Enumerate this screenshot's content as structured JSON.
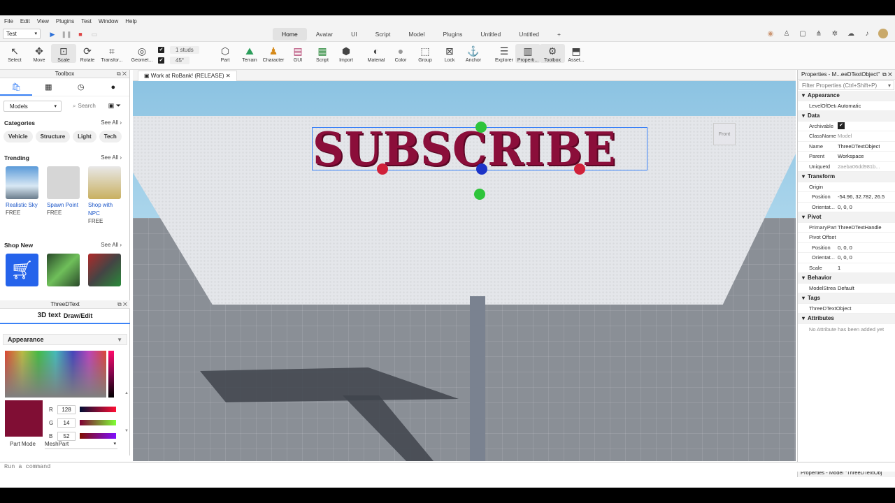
{
  "menu": [
    "File",
    "Edit",
    "View",
    "Plugins",
    "Test",
    "Window",
    "Help"
  ],
  "test_select": "Test",
  "ribbon_tabs": [
    "Home",
    "Avatar",
    "UI",
    "Script",
    "Model",
    "Plugins",
    "Untitled",
    "Untitled",
    "+"
  ],
  "tools": [
    {
      "label": "Select",
      "icon": "↖"
    },
    {
      "label": "Move",
      "icon": "✥"
    },
    {
      "label": "Scale",
      "icon": "⊡"
    },
    {
      "label": "Rotate",
      "icon": "⟳"
    },
    {
      "label": "Transfor...",
      "icon": "⌗"
    },
    {
      "label": "Geomet...",
      "icon": "◎"
    },
    {
      "label": "Part",
      "icon": "⬡"
    },
    {
      "label": "Terrain",
      "icon": "⛰"
    },
    {
      "label": "Character",
      "icon": "♟"
    },
    {
      "label": "GUI",
      "icon": "▤"
    },
    {
      "label": "Script",
      "icon": "▦"
    },
    {
      "label": "Import",
      "icon": "⬢"
    },
    {
      "label": "Material",
      "icon": "◐"
    },
    {
      "label": "Color",
      "icon": "●"
    },
    {
      "label": "Group",
      "icon": "⬚"
    },
    {
      "label": "Lock",
      "icon": "⊠"
    },
    {
      "label": "Anchor",
      "icon": "⚓"
    },
    {
      "label": "Explorer",
      "icon": "☰"
    },
    {
      "label": "Properti...",
      "icon": "▥"
    },
    {
      "label": "Toolbox",
      "icon": "⚙"
    },
    {
      "label": "Asset...",
      "icon": "⬒"
    }
  ],
  "snap": {
    "move": "1 studs",
    "rotate": "45°"
  },
  "toolbox": {
    "title": "Toolbox",
    "category_select": "Models",
    "search_placeholder": "Search",
    "categories_heading": "Categories",
    "see_all": "See All",
    "chips": [
      "Vehicle",
      "Structure",
      "Light",
      "Tech"
    ],
    "trending_heading": "Trending",
    "trending": [
      {
        "name": "Realistic Sky",
        "price": "FREE"
      },
      {
        "name": "Spawn Point",
        "price": "FREE"
      },
      {
        "name": "Shop with NPC",
        "price": "FREE"
      }
    ],
    "shopnew_heading": "Shop New"
  },
  "threedtext": {
    "title": "ThreeDText",
    "logo": "3D text",
    "mode": "Draw/Edit",
    "appearance": "Appearance",
    "r": "128",
    "g": "14",
    "b": "52",
    "color": "#800e34",
    "part_mode_label": "Part Mode",
    "part_mode_value": "MeshPart"
  },
  "doc_tab": "Work at RoBank! (RELEASE)",
  "viewport": {
    "sign_text": "SUBSCRIBE",
    "view_cube": "Front"
  },
  "properties": {
    "title": "Properties - M...eeDTextObject\"",
    "filter_placeholder": "Filter Properties (Ctrl+Shift+P)",
    "sections": [
      {
        "name": "Appearance",
        "rows": [
          {
            "k": "LevelOfDetail",
            "v": "Automatic"
          }
        ]
      },
      {
        "name": "Data",
        "rows": [
          {
            "k": "Archivable",
            "v": "✔"
          },
          {
            "k": "ClassName",
            "v": "Model",
            "gray": true
          },
          {
            "k": "Name",
            "v": "ThreeDTextObject"
          },
          {
            "k": "Parent",
            "v": "Workspace"
          },
          {
            "k": "UniqueId",
            "v": "2aeba06dd981b...",
            "gray": true
          }
        ]
      },
      {
        "name": "Transform",
        "rows": [
          {
            "k": "Origin",
            "v": "",
            "sub": false
          },
          {
            "k": "Position",
            "v": "-54.96, 32.782, 26.5",
            "sub": true
          },
          {
            "k": "Orientat...",
            "v": "0, 0, 0",
            "sub": true
          }
        ]
      },
      {
        "name": "Pivot",
        "rows": [
          {
            "k": "PrimaryPart",
            "v": "ThreeDTextHandle"
          },
          {
            "k": "Pivot Offset",
            "v": ""
          },
          {
            "k": "Position",
            "v": "0, 0, 0",
            "sub": true
          },
          {
            "k": "Orientat...",
            "v": "0, 0, 0",
            "sub": true
          },
          {
            "k": "Scale",
            "v": "1"
          }
        ]
      },
      {
        "name": "Behavior",
        "rows": [
          {
            "k": "ModelStrea...",
            "v": "Default"
          }
        ]
      },
      {
        "name": "Tags",
        "rows": [
          {
            "k": "ThreeDTextObject",
            "v": ""
          }
        ]
      },
      {
        "name": "Attributes",
        "rows": []
      }
    ],
    "no_attr": "No Attribute has been added yet",
    "bottom": "Properties - Model \"ThreeDTextObj"
  },
  "command_placeholder": "Run a command"
}
